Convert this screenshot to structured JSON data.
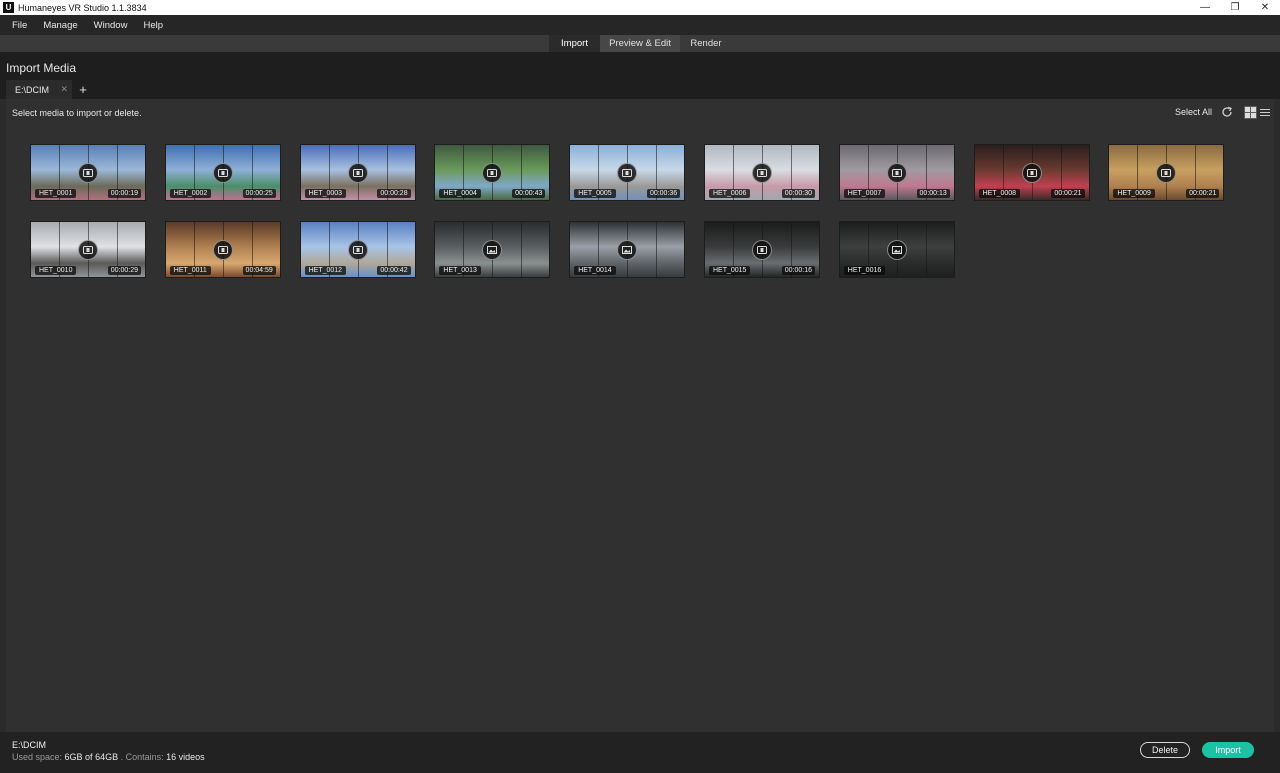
{
  "window": {
    "title": "Humaneyes VR Studio 1.1.3834",
    "app_icon": "U"
  },
  "menu": [
    "File",
    "Manage",
    "Window",
    "Help"
  ],
  "tabs": [
    {
      "label": "Import",
      "active": true
    },
    {
      "label": "Preview & Edit",
      "active": false
    },
    {
      "label": "Render",
      "active": false
    }
  ],
  "page": {
    "title": "Import Media",
    "folder_tab": "E:\\DCIM",
    "instruction": "Select media to import or delete.",
    "select_all": "Select All"
  },
  "media": [
    {
      "name": "HET_0001",
      "duration": "00:00:19",
      "kind": "video",
      "palette": [
        "#5a7fb6",
        "#9bb8d8",
        "#6b6b5a",
        "#b07080"
      ]
    },
    {
      "name": "HET_0002",
      "duration": "00:00:25",
      "kind": "video",
      "palette": [
        "#3f6fb0",
        "#8fb0d8",
        "#4a8f6a",
        "#c07090"
      ]
    },
    {
      "name": "HET_0003",
      "duration": "00:00:28",
      "kind": "video",
      "palette": [
        "#4a6db8",
        "#a8c0e0",
        "#7a7060",
        "#c090a8"
      ]
    },
    {
      "name": "HET_0004",
      "duration": "00:00:43",
      "kind": "video",
      "palette": [
        "#3e5a40",
        "#6a9a5a",
        "#7fa8c8",
        "#4a6a40"
      ]
    },
    {
      "name": "HET_0005",
      "duration": "00:00:36",
      "kind": "video",
      "palette": [
        "#8ab0d8",
        "#c8d8e8",
        "#9a9a98",
        "#7090b8"
      ]
    },
    {
      "name": "HET_0006",
      "duration": "00:00:30",
      "kind": "video",
      "palette": [
        "#b0b8c0",
        "#d8dde2",
        "#c89aa8",
        "#a0a8b0"
      ]
    },
    {
      "name": "HET_0007",
      "duration": "00:00:13",
      "kind": "video",
      "palette": [
        "#6a6a70",
        "#a09aa0",
        "#c07890",
        "#58585e"
      ]
    },
    {
      "name": "HET_0008",
      "duration": "00:00:21",
      "kind": "video",
      "palette": [
        "#2a1e1e",
        "#6a3a30",
        "#c04050",
        "#3a2a28"
      ]
    },
    {
      "name": "HET_0009",
      "duration": "00:00:21",
      "kind": "video",
      "palette": [
        "#8a6a40",
        "#c8a060",
        "#b08050",
        "#6a4a30"
      ]
    },
    {
      "name": "HET_0010",
      "duration": "00:00:29",
      "kind": "video",
      "palette": [
        "#a8acb0",
        "#e0e2e4",
        "#5a5a58",
        "#909498"
      ]
    },
    {
      "name": "HET_0011",
      "duration": "00:04:59",
      "kind": "video",
      "palette": [
        "#5a3a28",
        "#b08050",
        "#d8a870",
        "#7a4a30"
      ]
    },
    {
      "name": "HET_0012",
      "duration": "00:00:42",
      "kind": "video",
      "palette": [
        "#5a80c0",
        "#a8c4e8",
        "#b0a898",
        "#6a90c8"
      ]
    },
    {
      "name": "HET_0013",
      "duration": "",
      "kind": "photo",
      "palette": [
        "#2a2c2e",
        "#5a5e60",
        "#8a9090",
        "#3a3c3e"
      ]
    },
    {
      "name": "HET_0014",
      "duration": "",
      "kind": "photo",
      "palette": [
        "#2e3032",
        "#9aa0a8",
        "#606468",
        "#383a3c"
      ]
    },
    {
      "name": "HET_0015",
      "duration": "00:00:16",
      "kind": "video",
      "palette": [
        "#1a1c1c",
        "#3a3c3c",
        "#6a6e70",
        "#242626"
      ]
    },
    {
      "name": "HET_0016",
      "duration": "",
      "kind": "photo",
      "palette": [
        "#1c1e1e",
        "#3e4040",
        "#2a2c2c",
        "#1e2020"
      ]
    }
  ],
  "footer": {
    "path": "E:\\DCIM",
    "used_label": "Used space:",
    "used_value": "6GB of 64GB",
    "contains_label": ". Contains:",
    "contains_value": "16 videos",
    "delete_label": "Delete",
    "import_label": "Import"
  },
  "colors": {
    "accent": "#19c3a3",
    "background": "#303030",
    "header": "#1e1e1e"
  }
}
